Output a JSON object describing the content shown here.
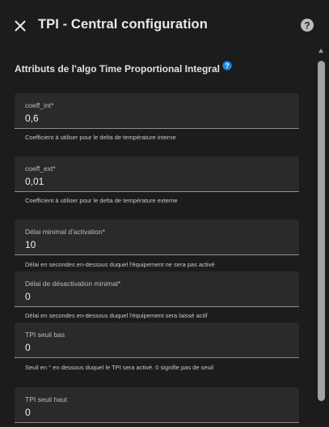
{
  "dialog": {
    "title": "TPI - Central configuration",
    "close_icon": "close-icon",
    "help_icon": "help-circle-icon"
  },
  "section": {
    "title": "Attributs de l'algo Time Proportional Integral",
    "help_icon": "help-circle-icon"
  },
  "fields": [
    {
      "label": "coeff_int*",
      "value": "0,6",
      "helper": "Coefficient à utiliser pour le delta de température interne"
    },
    {
      "label": "coeff_ext*",
      "value": "0,01",
      "helper": "Coefficient à utiliser pour le delta de température externe"
    },
    {
      "label": "Délai minimal d'activation*",
      "value": "10",
      "helper": "Délai en secondes en-dessous duquel l'équipement ne sera pas activé"
    },
    {
      "label": "Délai de désactivation minimal*",
      "value": "0",
      "helper": "Délai en secondes en-dessous duquel l'équipement sera laissé actif"
    },
    {
      "label": "TPI seuil bas",
      "value": "0",
      "helper": "Seuil en ° en dessous duquel le TPI sera activé. 0 signifie pas de seuil"
    },
    {
      "label": "TPI seuil haut",
      "value": "0",
      "helper": ""
    }
  ],
  "colors": {
    "background": "#1c1c1c",
    "field_background": "#2a2a2a",
    "accent": "#1e88e5",
    "text": "#e1e1e1"
  }
}
